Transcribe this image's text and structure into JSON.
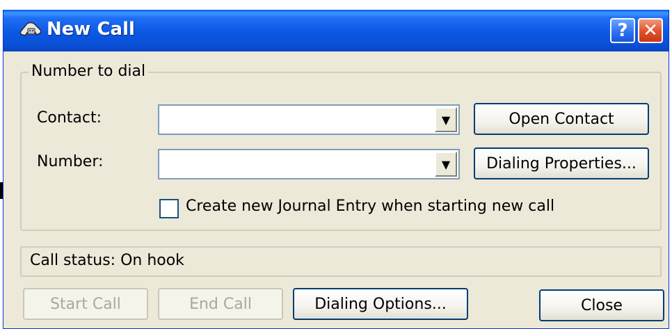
{
  "window": {
    "title": "New Call",
    "help_label": "?",
    "close_label": "✕"
  },
  "group": {
    "legend": "Number to dial",
    "contact_label": "Contact:",
    "number_label": "Number:",
    "contact_value": "",
    "number_value": "",
    "open_contact_label": "Open Contact",
    "dialing_properties_label": "Dialing Properties...",
    "journal_checkbox_label": "Create new Journal Entry when starting new call",
    "journal_checked": false
  },
  "status": {
    "text": "Call status: On hook"
  },
  "buttons": {
    "start_call": "Start Call",
    "end_call": "End Call",
    "dialing_options": "Dialing Options...",
    "close": "Close"
  },
  "icons": {
    "title": "phone-icon",
    "dropdown": "chevron-down-icon"
  },
  "colors": {
    "titlebar": "#0b58e2",
    "dialog_bg": "#ece9d8",
    "close_button": "#e0502a",
    "help_button": "#2b6ef0"
  }
}
